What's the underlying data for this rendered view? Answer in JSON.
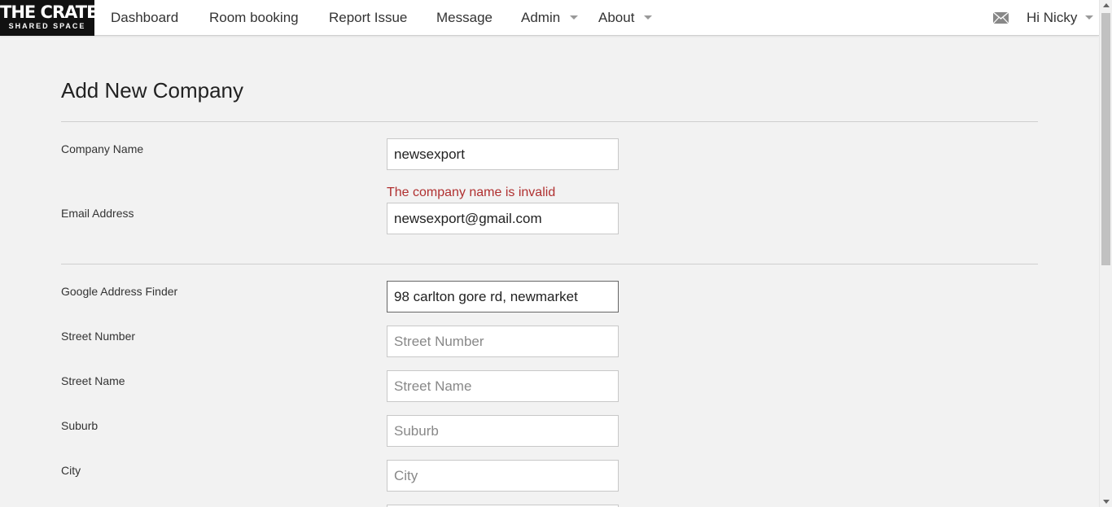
{
  "app": {
    "logo_main": "THE CRATE",
    "logo_sub": "SHARED SPACE"
  },
  "nav": {
    "items": [
      {
        "label": "Dashboard"
      },
      {
        "label": "Room booking"
      },
      {
        "label": "Report Issue"
      },
      {
        "label": "Message"
      },
      {
        "label": "Admin"
      },
      {
        "label": "About"
      }
    ],
    "mail_icon": "envelope-icon",
    "greeting": "Hi Nicky"
  },
  "form": {
    "title": "Add New Company",
    "company_name": {
      "label": "Company Name",
      "value": "newsexport"
    },
    "error": "The company name is invalid",
    "email": {
      "label": "Email Address",
      "value": "newsexport@gmail.com"
    },
    "address_finder": {
      "label": "Google Address Finder",
      "value": "98 carlton gore rd, newmarket"
    },
    "street_number": {
      "label": "Street Number",
      "placeholder": "Street Number"
    },
    "street_name": {
      "label": "Street Name",
      "placeholder": "Street Name"
    },
    "suburb": {
      "label": "Suburb",
      "placeholder": "Suburb"
    },
    "city": {
      "label": "City",
      "placeholder": "City"
    }
  },
  "colors": {
    "error": "#b03030",
    "logo_bg": "#111111",
    "page_bg": "#f2f2f2"
  }
}
